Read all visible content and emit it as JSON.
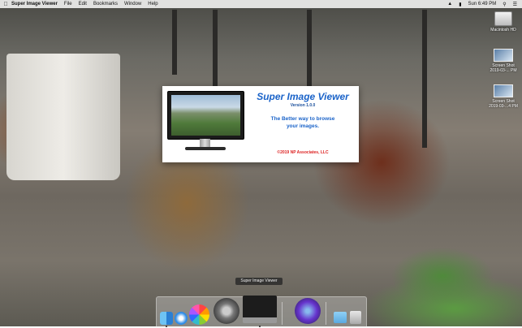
{
  "menubar": {
    "app_name": "Super Image Viewer",
    "menus": [
      "File",
      "Edit",
      "Bookmarks",
      "Window",
      "Help"
    ],
    "clock": "Sun 6:49 PM"
  },
  "desktop_icons": [
    {
      "label": "Macintosh HD"
    },
    {
      "label": "Screen Shot 2019-03-... PM"
    },
    {
      "label": "Screen Shot 2019-03-...4 PM"
    }
  ],
  "splash": {
    "title": "Super Image Viewer",
    "version": "Version 1.0.0",
    "tagline_line1": "The Better way to browse",
    "tagline_line2": "your images.",
    "copyright": "©2019 NP Associates, LLC"
  },
  "dock": {
    "tooltip": "Super Image Viewer",
    "items": [
      "finder",
      "safari",
      "photos",
      "system-preferences",
      "super-image-viewer",
      "video-app",
      "downloads-folder",
      "trash"
    ]
  },
  "colors": {
    "title_blue": "#1a63c9",
    "copyright_red": "#dd2222",
    "menubar_bg": "#eeeeee"
  }
}
